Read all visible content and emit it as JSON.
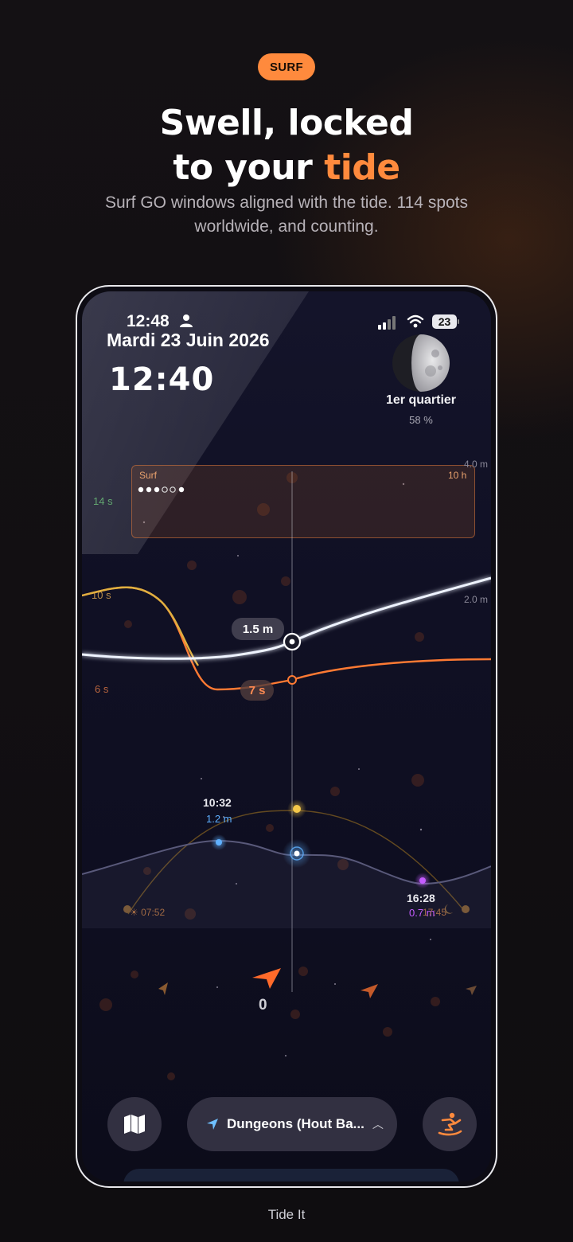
{
  "promo": {
    "badge": "SURF",
    "title_line1": "Swell, locked",
    "title_line2_prefix": "to your ",
    "title_line2_accent": "tide",
    "subtitle_line1": "Surf GO windows aligned with the tide. 114 spots",
    "subtitle_line2": "worldwide, and counting.",
    "app_name": "Tide It"
  },
  "status_bar": {
    "time": "12:48",
    "battery": "23",
    "icons": [
      "person-icon",
      "signal-icon",
      "wifi-icon",
      "battery-icon"
    ]
  },
  "header": {
    "date": "Mardi 23 Juin 2026",
    "current_time": "12:40"
  },
  "moon": {
    "phase": "1er quartier",
    "illumination": "58 %"
  },
  "swell_chart": {
    "surf_window_label": "Surf",
    "surf_window_hours": "10 h",
    "surf_rating_filled": 3,
    "surf_rating_total": 5,
    "height_axis": [
      "4.0 m",
      "2.0 m"
    ],
    "period_axis": [
      "14 s",
      "10 s",
      "6 s"
    ],
    "current_height": "1.5 m",
    "current_period": "7 s"
  },
  "tide_chart": {
    "high_time": "10:32",
    "high_height": "1.2 m",
    "low_time": "16:28",
    "low_height": "0.7 m",
    "sunrise": "07:52",
    "sunset": "17:45"
  },
  "wind": {
    "speed": "0"
  },
  "bottom_bar": {
    "location": "Dungeons (Hout Ba...",
    "icons": [
      "map-icon",
      "location-arrow-icon",
      "chevron-up-icon",
      "surfer-icon"
    ]
  },
  "colors": {
    "accent": "#ff8a3d",
    "swell_height_line": "#e8eef8",
    "swell_period_line": "#ff7a33",
    "tide_high": "#5fb0ff",
    "tide_low": "#c45cff",
    "sun": "#f5c84a"
  }
}
